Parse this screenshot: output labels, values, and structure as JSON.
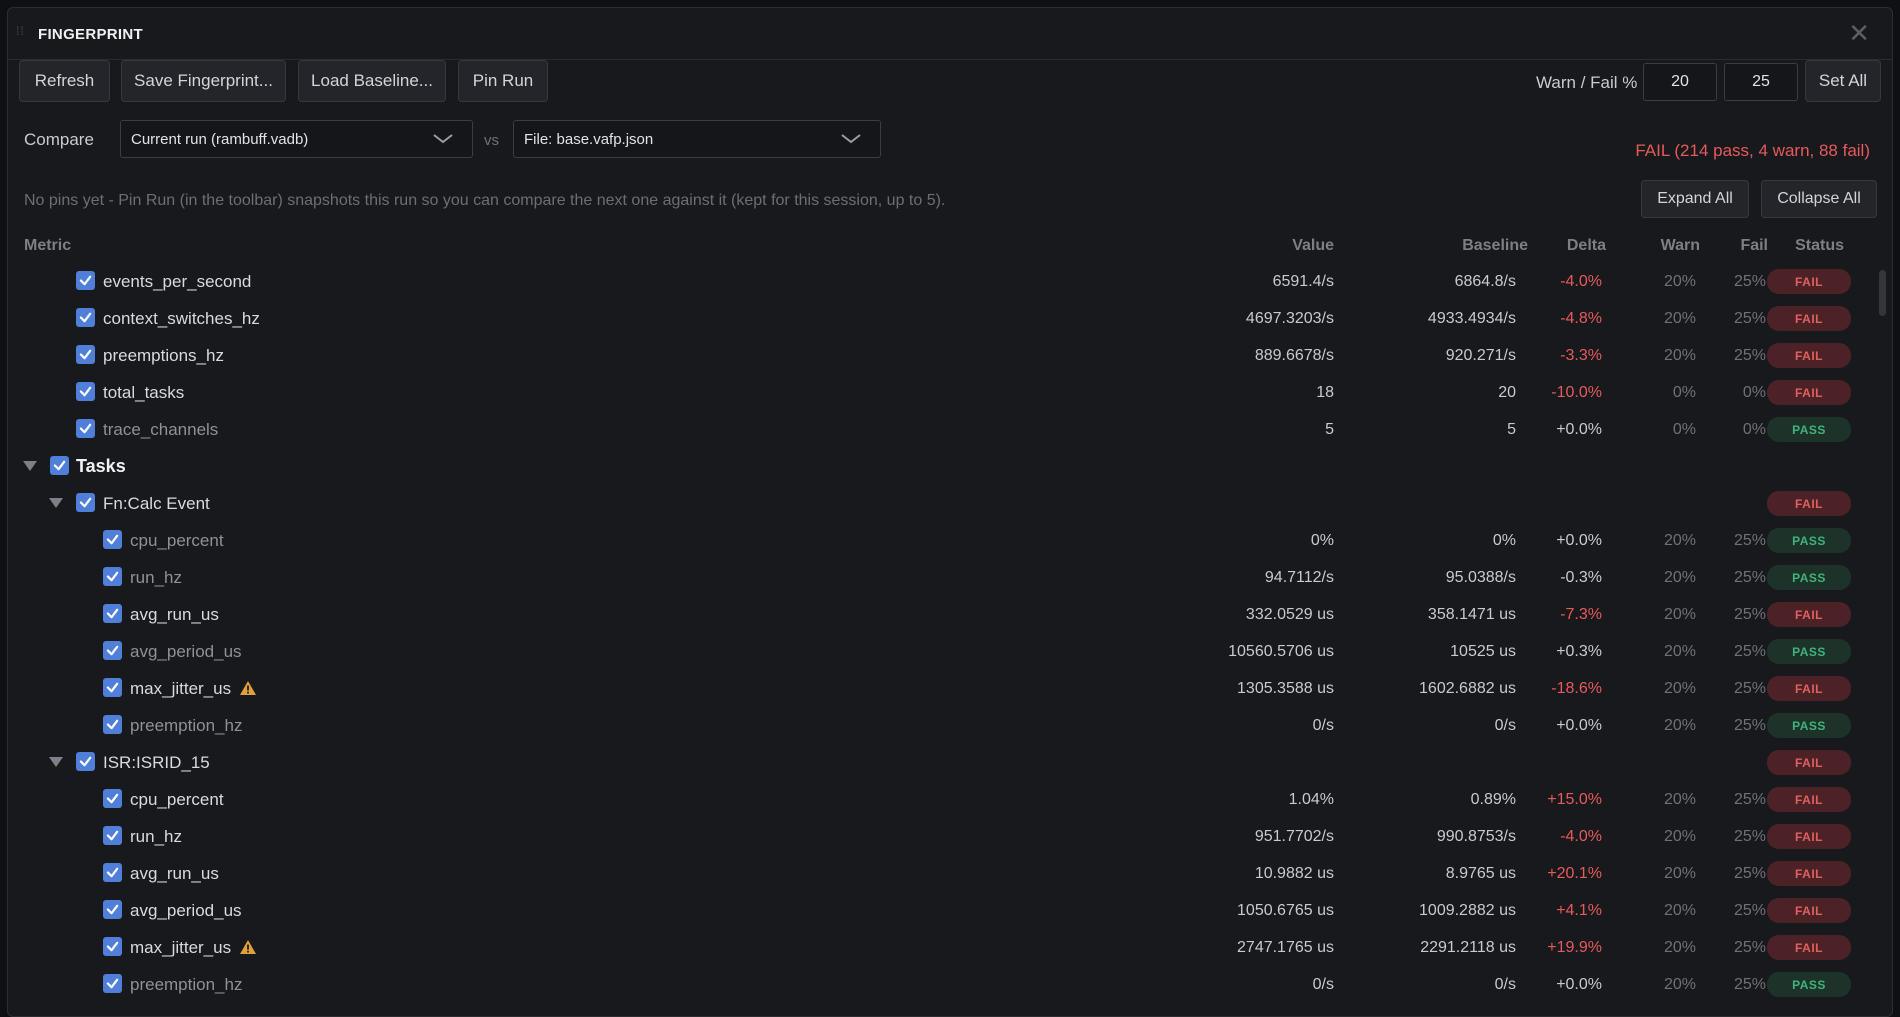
{
  "window": {
    "title": "FINGERPRINT",
    "close": "✕"
  },
  "toolbar": {
    "refresh": "Refresh",
    "save": "Save Fingerprint...",
    "load": "Load Baseline...",
    "pin": "Pin Run",
    "threshold_label": "Warn / Fail %",
    "warn_value": "20",
    "fail_value": "25",
    "set_all": "Set All"
  },
  "compare": {
    "label": "Compare",
    "current": "Current run (rambuff.vadb)",
    "vs": "vs",
    "baseline": "File: base.vafp.json",
    "summary": "FAIL  (214 pass, 4 warn, 88 fail)"
  },
  "hint": "No pins yet - Pin Run (in the toolbar) snapshots this run so you can compare the next one against it (kept for this session, up to 5).",
  "expand_all": "Expand All",
  "collapse_all": "Collapse All",
  "columns": {
    "metric": "Metric",
    "value": "Value",
    "baseline": "Baseline",
    "delta": "Delta",
    "warn": "Warn",
    "fail": "Fail",
    "status": "Status"
  },
  "colors": {
    "accent": "#4f7fd9",
    "fail": "#e65a5a",
    "pass": "#3fb37d"
  },
  "rows": [
    {
      "name": "events_per_second",
      "value": "6591.4/s",
      "baseline": "6864.8/s",
      "delta": "-4.0%",
      "warn": "20%",
      "fail": "25%",
      "status": "FAIL"
    },
    {
      "name": "context_switches_hz",
      "value": "4697.3203/s",
      "baseline": "4933.4934/s",
      "delta": "-4.8%",
      "warn": "20%",
      "fail": "25%",
      "status": "FAIL"
    },
    {
      "name": "preemptions_hz",
      "value": "889.6678/s",
      "baseline": "920.271/s",
      "delta": "-3.3%",
      "warn": "20%",
      "fail": "25%",
      "status": "FAIL"
    },
    {
      "name": "total_tasks",
      "value": "18",
      "baseline": "20",
      "delta": "-10.0%",
      "warn": "0%",
      "fail": "0%",
      "status": "FAIL"
    },
    {
      "name": "trace_channels",
      "value": "5",
      "baseline": "5",
      "delta": "+0.0%",
      "warn": "0%",
      "fail": "0%",
      "status": "PASS"
    },
    {
      "name": "Tasks",
      "group": true
    },
    {
      "name": "Fn:Calc Event",
      "subgroup": true,
      "status": "FAIL"
    },
    {
      "name": "cpu_percent",
      "value": "0%",
      "baseline": "0%",
      "delta": "+0.0%",
      "warn": "20%",
      "fail": "25%",
      "status": "PASS"
    },
    {
      "name": "run_hz",
      "value": "94.7112/s",
      "baseline": "95.0388/s",
      "delta": "-0.3%",
      "warn": "20%",
      "fail": "25%",
      "status": "PASS"
    },
    {
      "name": "avg_run_us",
      "value": "332.0529 us",
      "baseline": "358.1471 us",
      "delta": "-7.3%",
      "warn": "20%",
      "fail": "25%",
      "status": "FAIL"
    },
    {
      "name": "avg_period_us",
      "value": "10560.5706 us",
      "baseline": "10525 us",
      "delta": "+0.3%",
      "warn": "20%",
      "fail": "25%",
      "status": "PASS"
    },
    {
      "name": "max_jitter_us",
      "warnflag": true,
      "value": "1305.3588 us",
      "baseline": "1602.6882 us",
      "delta": "-18.6%",
      "warn": "20%",
      "fail": "25%",
      "status": "FAIL"
    },
    {
      "name": "preemption_hz",
      "value": "0/s",
      "baseline": "0/s",
      "delta": "+0.0%",
      "warn": "20%",
      "fail": "25%",
      "status": "PASS"
    },
    {
      "name": "ISR:ISRID_15",
      "subgroup": true,
      "status": "FAIL"
    },
    {
      "name": "cpu_percent",
      "value": "1.04%",
      "baseline": "0.89%",
      "delta": "+15.0%",
      "warn": "20%",
      "fail": "25%",
      "status": "FAIL"
    },
    {
      "name": "run_hz",
      "value": "951.7702/s",
      "baseline": "990.8753/s",
      "delta": "-4.0%",
      "warn": "20%",
      "fail": "25%",
      "status": "FAIL"
    },
    {
      "name": "avg_run_us",
      "value": "10.9882 us",
      "baseline": "8.9765 us",
      "delta": "+20.1%",
      "warn": "20%",
      "fail": "25%",
      "status": "FAIL"
    },
    {
      "name": "avg_period_us",
      "value": "1050.6765 us",
      "baseline": "1009.2882 us",
      "delta": "+4.1%",
      "warn": "20%",
      "fail": "25%",
      "status": "FAIL"
    },
    {
      "name": "max_jitter_us",
      "warnflag": true,
      "value": "2747.1765 us",
      "baseline": "2291.2118 us",
      "delta": "+19.9%",
      "warn": "20%",
      "fail": "25%",
      "status": "FAIL"
    },
    {
      "name": "preemption_hz",
      "value": "0/s",
      "baseline": "0/s",
      "delta": "+0.0%",
      "warn": "20%",
      "fail": "25%",
      "status": "PASS"
    }
  ]
}
